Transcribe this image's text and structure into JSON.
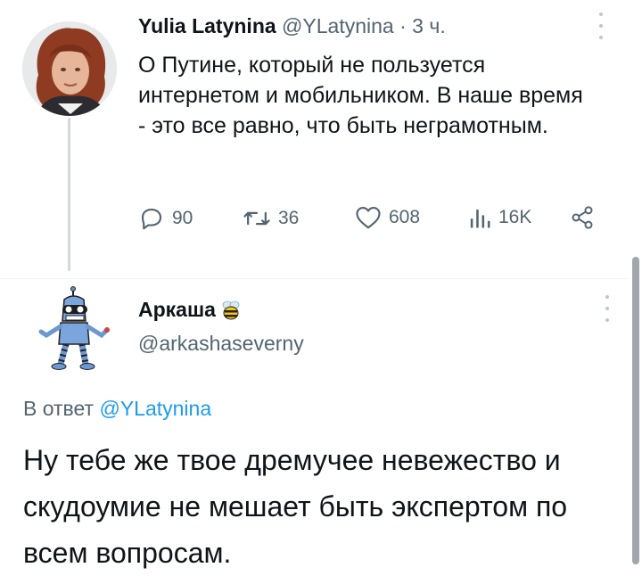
{
  "tweet1": {
    "author_name": "Yulia Latynina",
    "handle": "@YLatynina",
    "time": "3 ч.",
    "text": "О Путине, который не пользуется интернетом и мобильником. В наше время - это все равно, что быть неграмотным.",
    "replies": "90",
    "retweets": "36",
    "likes": "608",
    "views": "16K"
  },
  "tweet2": {
    "author_name": "Аркаша",
    "handle": "@arkashaseverny",
    "reply_prefix": "В ответ",
    "reply_to": "@YLatynina",
    "text": "Ну тебе же твое дремучее невежество и скудоумие не мешает быть экспертом по всем вопросам."
  },
  "icons": {
    "reply": "reply-icon",
    "retweet": "retweet-icon",
    "like": "heart-icon",
    "views": "analytics-icon",
    "share": "share-icon",
    "more": "more-dots-icon",
    "bee": "bee-emoji-icon"
  },
  "colors": {
    "link": "#1d9bf0",
    "secondary_text": "#536471",
    "primary_text": "#0f1419"
  }
}
